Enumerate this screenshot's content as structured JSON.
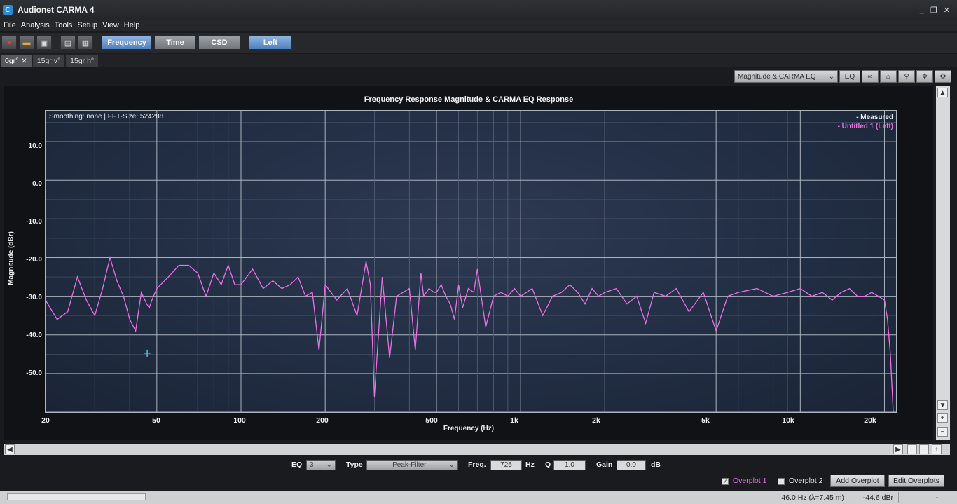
{
  "window": {
    "app_icon": "C",
    "title": "Audionet CARMA 4",
    "controls": [
      "_",
      "❐",
      "✕"
    ]
  },
  "menu": [
    "File",
    "Analysis",
    "Tools",
    "Setup",
    "View",
    "Help"
  ],
  "toolbar": {
    "icons": [
      "record-icon",
      "folder-icon",
      "save-icon",
      "export-icon",
      "print-icon"
    ],
    "buttons": {
      "frequency": "Frequency",
      "time": "Time",
      "csd": "CSD",
      "left": "Left"
    }
  },
  "tabs": [
    {
      "label": "0gr°",
      "active": true,
      "closable": true
    },
    {
      "label": "15gr v°",
      "active": false,
      "closable": false
    },
    {
      "label": "15gr h°",
      "active": false,
      "closable": false
    }
  ],
  "graph_toolbar": {
    "view_select": "Magnitude & CARMA EQ",
    "eq_button": "EQ",
    "icons": [
      "link-icon",
      "home-icon",
      "zoom-icon",
      "pan-icon",
      "settings-icon"
    ]
  },
  "chart": {
    "title": "Frequency Response Magnitude & CARMA EQ Response",
    "info": "Smoothing: none | FFT-Size: 524288",
    "legend": [
      "- Measured",
      "- Untitled 1 (Left)"
    ],
    "ylabel": "Magnitude (dBr)",
    "xlabel": "Frequency (Hz)",
    "y_ticks": [
      "10.0",
      "0.0",
      "-10.0",
      "-20.0",
      "-30.0",
      "-40.0",
      "-50.0"
    ],
    "x_ticks": [
      "20",
      "50",
      "100",
      "200",
      "500",
      "1k",
      "2k",
      "5k",
      "10k",
      "20k"
    ],
    "cursor_marker": "+"
  },
  "chart_data": {
    "type": "line",
    "title": "Frequency Response Magnitude & CARMA EQ Response",
    "xlabel": "Frequency (Hz)",
    "ylabel": "Magnitude (dBr)",
    "x_scale": "log",
    "xlim": [
      20,
      22000
    ],
    "ylim": [
      -60,
      18
    ],
    "grid": true,
    "legend_position": "top-right",
    "series": [
      {
        "name": "Untitled 1 (Left)",
        "color": "#ee6fe6",
        "x": [
          20,
          22,
          24,
          26,
          28,
          30,
          32,
          34,
          36,
          38,
          40,
          42,
          44,
          46,
          47,
          48,
          50,
          55,
          60,
          65,
          70,
          75,
          80,
          85,
          90,
          95,
          100,
          110,
          120,
          130,
          140,
          150,
          160,
          170,
          180,
          190,
          200,
          220,
          240,
          260,
          280,
          290,
          300,
          320,
          340,
          360,
          380,
          400,
          420,
          440,
          450,
          470,
          490,
          500,
          520,
          540,
          560,
          580,
          600,
          620,
          650,
          680,
          700,
          750,
          800,
          850,
          900,
          950,
          1000,
          1100,
          1200,
          1300,
          1400,
          1500,
          1600,
          1700,
          1800,
          1900,
          2000,
          2200,
          2400,
          2600,
          2800,
          3000,
          3300,
          3600,
          4000,
          4500,
          5000,
          5500,
          6000,
          7000,
          8000,
          9000,
          10000,
          11000,
          12000,
          13000,
          14000,
          15000,
          16000,
          17000,
          18000,
          19000,
          20000,
          20500,
          21000,
          21500,
          22000
        ],
        "y": [
          -31,
          -36,
          -34,
          -25,
          -31,
          -35,
          -28,
          -20,
          -26,
          -30,
          -36,
          -39,
          -29,
          -32,
          -33,
          -31,
          -28,
          -25,
          -22,
          -22,
          -24,
          -30,
          -24,
          -27,
          -22,
          -27,
          -27,
          -23,
          -28,
          -26,
          -28,
          -27,
          -25,
          -30,
          -29,
          -44,
          -27,
          -31,
          -28,
          -35,
          -21,
          -27,
          -56,
          -25,
          -46,
          -30,
          -29,
          -28,
          -44,
          -24,
          -30,
          -28,
          -29,
          -29,
          -27,
          -30,
          -32,
          -36,
          -27,
          -33,
          -28,
          -29,
          -23,
          -38,
          -30,
          -29,
          -30,
          -28,
          -30,
          -28,
          -35,
          -30,
          -29,
          -27,
          -29,
          -32,
          -28,
          -30,
          -29,
          -28,
          -32,
          -30,
          -37,
          -29,
          -30,
          -28,
          -34,
          -29,
          -39,
          -30,
          -29,
          -28,
          -30,
          -29,
          -28,
          -30,
          -29,
          -31,
          -29,
          -28,
          -30,
          -30,
          -29,
          -30,
          -31,
          -36,
          -45,
          -60,
          -60
        ]
      }
    ]
  },
  "eq_controls": {
    "eq_label": "EQ",
    "eq_value": "3",
    "type_label": "Type",
    "type_value": "Peak-Filter",
    "freq_label": "Freq.",
    "freq_value": "725",
    "freq_unit": "Hz",
    "q_label": "Q",
    "q_value": "1.0",
    "gain_label": "Gain",
    "gain_value": "0.0",
    "gain_unit": "dB"
  },
  "overplots": {
    "overplot1": {
      "label": "Overplot 1",
      "checked": true,
      "color": "#ee6fe6"
    },
    "overplot2": {
      "label": "Overplot 2",
      "checked": false,
      "color": "#e8e8e8"
    },
    "add_button": "Add Overplot",
    "edit_button": "Edit Overplots"
  },
  "status": {
    "cursor_freq": "46.0 Hz (λ=7.45 m)",
    "cursor_mag": "-44.6 dBr",
    "extra": "-"
  }
}
